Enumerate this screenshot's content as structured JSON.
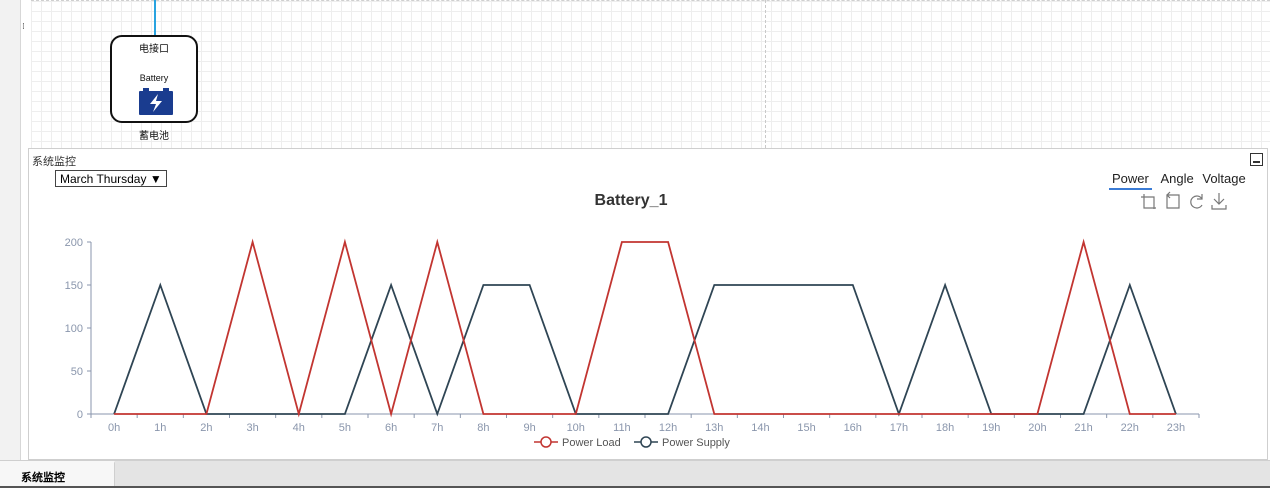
{
  "canvas": {
    "port_label": "电接口",
    "device_en_name": "Battery",
    "device_cn_name": "蓄电池"
  },
  "panel": {
    "title": "系统监控",
    "day_select": "March Thursday ▼",
    "tabs": [
      {
        "label": "Power",
        "active": true
      },
      {
        "label": "Angle",
        "active": false
      },
      {
        "label": "Voltage",
        "active": false
      }
    ]
  },
  "bottom_tab": {
    "label": "系统监控"
  },
  "colors": {
    "power_load": "#c23531",
    "power_supply": "#2f4554",
    "tab_underline": "#3a7bd5",
    "connector": "#29a3e0",
    "battery_icon": "#1a3c8f"
  },
  "toolbox": [
    "zoom-icon",
    "zoom-reset-icon",
    "restore-icon",
    "save-image-icon"
  ],
  "chart_data": {
    "type": "line",
    "title": "Battery_1",
    "categories": [
      "0h",
      "1h",
      "2h",
      "3h",
      "4h",
      "5h",
      "6h",
      "7h",
      "8h",
      "9h",
      "10h",
      "11h",
      "12h",
      "13h",
      "14h",
      "15h",
      "16h",
      "17h",
      "18h",
      "19h",
      "20h",
      "21h",
      "22h",
      "23h"
    ],
    "ylim": [
      0,
      200
    ],
    "yticks": [
      0,
      50,
      100,
      150,
      200
    ],
    "grid": false,
    "legend_position": "bottom",
    "series": [
      {
        "name": "Power Load",
        "color": "#c23531",
        "values": [
          0,
          0,
          0,
          200,
          0,
          200,
          0,
          200,
          0,
          0,
          0,
          200,
          200,
          0,
          0,
          0,
          0,
          0,
          0,
          0,
          0,
          200,
          0,
          0
        ]
      },
      {
        "name": "Power Supply",
        "color": "#2f4554",
        "values": [
          0,
          150,
          0,
          0,
          0,
          0,
          150,
          0,
          150,
          150,
          0,
          0,
          0,
          150,
          150,
          150,
          150,
          0,
          150,
          0,
          0,
          0,
          150,
          0
        ]
      }
    ]
  }
}
